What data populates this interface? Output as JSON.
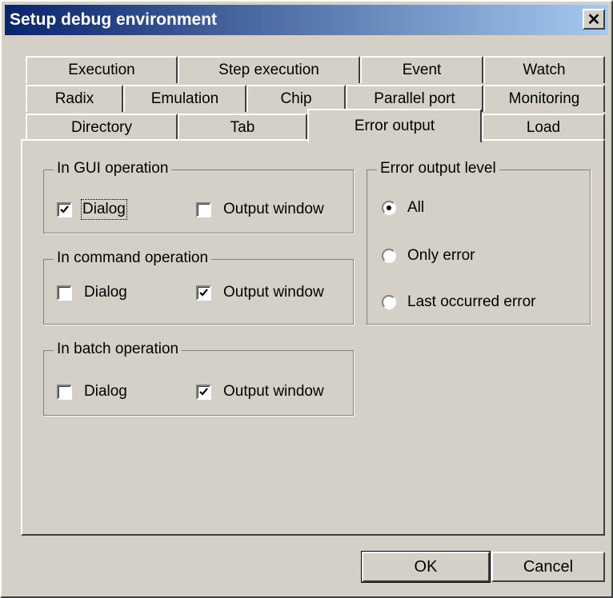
{
  "window": {
    "title": "Setup debug environment",
    "close_glyph": "✕"
  },
  "tabs": {
    "row1": [
      "Execution",
      "Step execution",
      "Event",
      "Watch"
    ],
    "row2": [
      "Radix",
      "Emulation",
      "Chip",
      "Parallel port",
      "Monitoring"
    ],
    "row3": [
      "Directory",
      "Tab",
      "Error output",
      "Load"
    ],
    "active": "Error output"
  },
  "gui_group": {
    "title": "In GUI operation",
    "dialog": {
      "label": "Dialog",
      "checked": true
    },
    "output_window": {
      "label": "Output window",
      "checked": false
    }
  },
  "command_group": {
    "title": "In command operation",
    "dialog": {
      "label": "Dialog",
      "checked": false
    },
    "output_window": {
      "label": "Output window",
      "checked": true
    }
  },
  "batch_group": {
    "title": "In batch operation",
    "dialog": {
      "label": "Dialog",
      "checked": false
    },
    "output_window": {
      "label": "Output window",
      "checked": true
    }
  },
  "level_group": {
    "title": "Error output level",
    "options": [
      {
        "label": "All",
        "selected": true
      },
      {
        "label": "Only error",
        "selected": false
      },
      {
        "label": "Last occurred error",
        "selected": false
      }
    ]
  },
  "buttons": {
    "ok": "OK",
    "cancel": "Cancel"
  },
  "colors": {
    "face": "#d4d0c8",
    "title_start": "#0a246a",
    "title_end": "#a6caf0"
  }
}
